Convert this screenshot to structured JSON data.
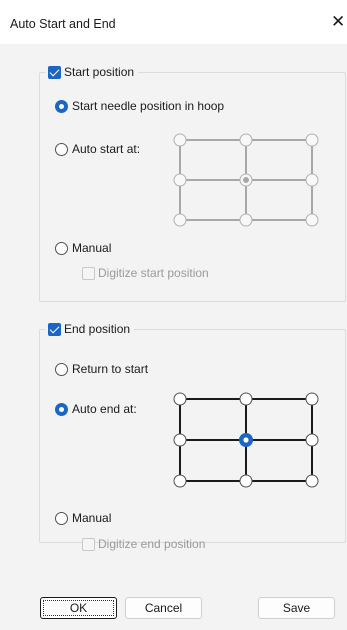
{
  "window": {
    "title": "Auto Start and End",
    "close_glyph": "✕",
    "close_icon": "close-icon"
  },
  "start_group": {
    "title": "Start position",
    "checked": true,
    "options": {
      "needle": {
        "label": "Start needle position in hoop",
        "selected": true
      },
      "auto": {
        "label": "Auto start at:",
        "selected": false
      },
      "manual": {
        "label": "Manual",
        "selected": false
      }
    },
    "digitize": {
      "label": "Digitize start position",
      "checked": false,
      "enabled": false
    },
    "grid": {
      "enabled": false,
      "selected": "center"
    }
  },
  "end_group": {
    "title": "End position",
    "checked": true,
    "options": {
      "return": {
        "label": "Return to start",
        "selected": false
      },
      "auto": {
        "label": "Auto end at:",
        "selected": true
      },
      "manual": {
        "label": "Manual",
        "selected": false
      }
    },
    "digitize": {
      "label": "Digitize end position",
      "checked": false,
      "enabled": false
    },
    "grid": {
      "enabled": true,
      "selected": "center"
    }
  },
  "buttons": {
    "ok": "OK",
    "cancel": "Cancel",
    "save": "Save"
  },
  "colors": {
    "accent": "#1a66c2",
    "disabled": "#9a9a9a",
    "grid_enabled": "#1a1a1a",
    "grid_disabled": "#a8a8a8"
  }
}
